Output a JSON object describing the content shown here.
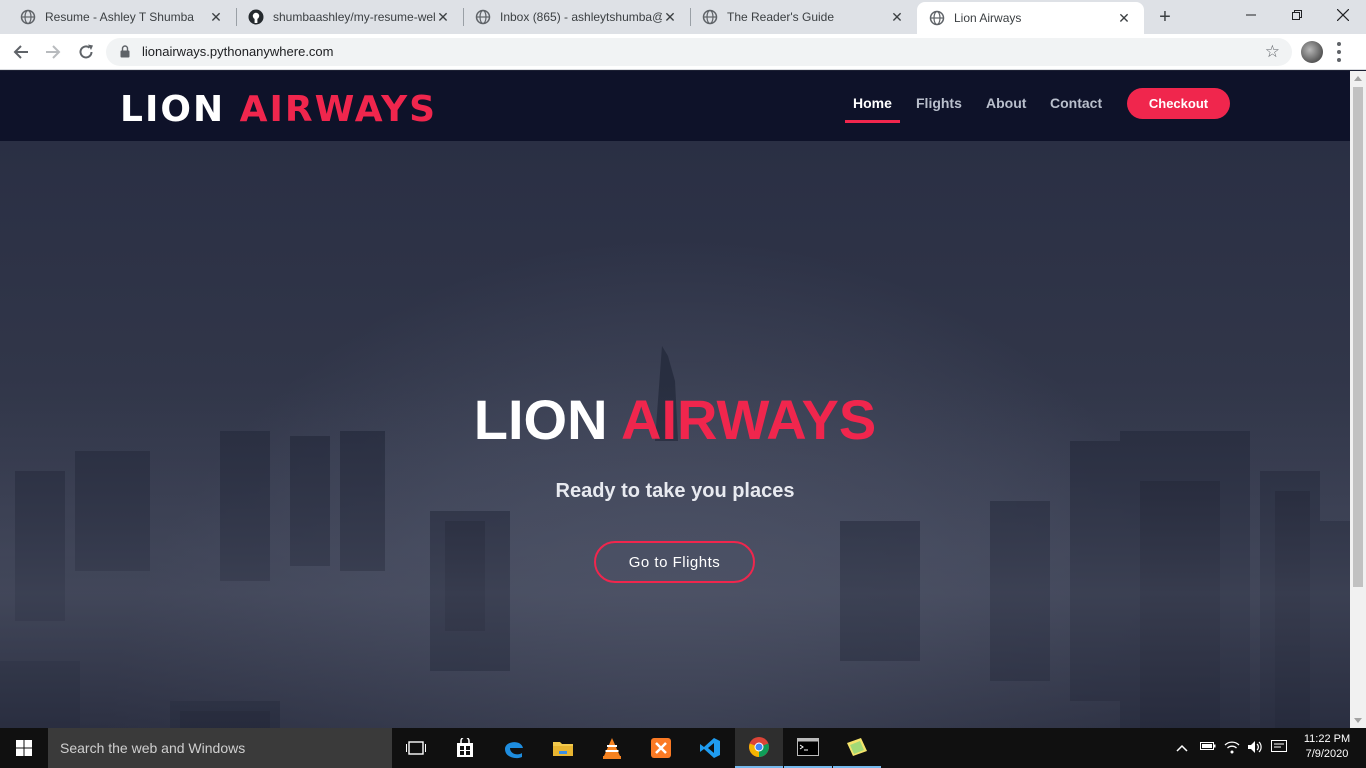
{
  "browser": {
    "tabs": [
      {
        "title": "Resume - Ashley T Shumba",
        "icon": "globe-icon"
      },
      {
        "title": "shumbaashley/my-resume-wel",
        "icon": "github-icon"
      },
      {
        "title": "Inbox (865) - ashleytshumba@",
        "icon": "globe-icon"
      },
      {
        "title": "The Reader's Guide",
        "icon": "globe-icon"
      },
      {
        "title": "Lion Airways",
        "icon": "globe-icon",
        "active": true
      }
    ],
    "new_tab_label": "+",
    "url": "lionairways.pythonanywhere.com"
  },
  "site": {
    "brand_main": "LION",
    "brand_accent": "AIRWAYS",
    "nav": {
      "home": "Home",
      "flights": "Flights",
      "about": "About",
      "contact": "Contact",
      "checkout": "Checkout"
    },
    "hero": {
      "title_main": "LION",
      "title_accent": "AIRWAYS",
      "subtitle": "Ready to take you places",
      "button": "Go to Flights"
    },
    "colors": {
      "accent": "#f0264d",
      "header_bg": "#0e1229"
    }
  },
  "taskbar": {
    "search_placeholder": "Search the web and Windows",
    "apps": [
      "task-view-icon",
      "store-icon",
      "edge-icon",
      "file-explorer-icon",
      "vlc-icon",
      "xampp-icon",
      "vscode-icon",
      "chrome-icon",
      "terminal-icon",
      "sticky-notes-icon"
    ],
    "time": "11:22 PM",
    "date": "7/9/2020"
  }
}
